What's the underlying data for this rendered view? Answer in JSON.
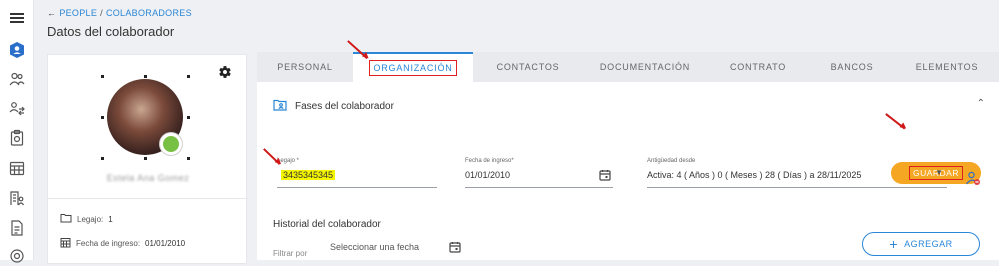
{
  "breadcrumb": {
    "back_icon": "arrow-left-icon",
    "parent": "PEOPLE",
    "separator": "/",
    "current": "COLABORADORES"
  },
  "page_title": "Datos del colaborador",
  "sidebar": {
    "items": [
      {
        "icon": "menu-icon"
      },
      {
        "icon": "user-profile-icon"
      },
      {
        "icon": "people-icon"
      },
      {
        "icon": "people-exchange-icon"
      },
      {
        "icon": "clipboard-icon"
      },
      {
        "icon": "calendar-grid-icon"
      },
      {
        "icon": "building-user-icon"
      },
      {
        "icon": "document-icon"
      },
      {
        "icon": "settings-icon"
      }
    ]
  },
  "profile": {
    "name": "Estela Ana Gomez",
    "status_color": "#78c043",
    "legajo_label": "Legajo:",
    "legajo_value": "1",
    "ingreso_label": "Fecha de ingreso:",
    "ingreso_value": "01/01/2010"
  },
  "tabs": [
    {
      "label": "PERSONAL",
      "active": false
    },
    {
      "label": "ORGANIZACIÓN",
      "active": true
    },
    {
      "label": "CONTACTOS",
      "active": false
    },
    {
      "label": "DOCUMENTACIÓN",
      "active": false
    },
    {
      "label": "CONTRATO",
      "active": false
    },
    {
      "label": "BANCOS",
      "active": false
    },
    {
      "label": "ELEMENTOS",
      "active": false
    }
  ],
  "section": {
    "title": "Fases del colaborador",
    "save_label": "GUARDAR",
    "legajo": {
      "label": "Legajo *",
      "value": "3435345345"
    },
    "fecha_ingreso": {
      "label": "Fecha de ingreso*",
      "value": "01/01/2010"
    },
    "antiguedad": {
      "label": "Antigüedad desde",
      "value": "Activa: 4 ( Años ) 0 ( Meses ) 28 ( Días ) a 28/11/2025"
    }
  },
  "history": {
    "title": "Historial del colaborador",
    "filter_label": "Filtrar por",
    "date_placeholder": "Seleccionar una fecha",
    "add_label": "AGREGAR"
  },
  "colors": {
    "accent": "#2a86d6",
    "save": "#f5a623",
    "annotation": "#e02020",
    "highlight": "#f5f500"
  }
}
